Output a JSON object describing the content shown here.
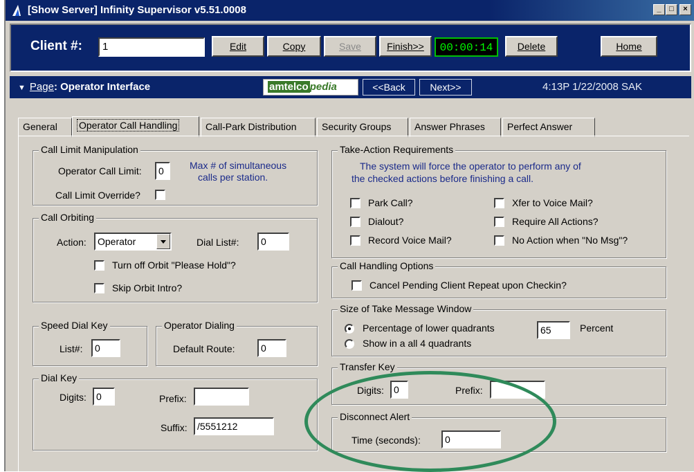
{
  "window": {
    "title": "[Show Server]  Infinity Supervisor  v5.51.0008",
    "controls": [
      "_",
      "□",
      "×"
    ]
  },
  "client_row": {
    "label": "Client #:",
    "client_value": "1",
    "buttons": {
      "edit": "Edit",
      "copy": "Copy",
      "save": "Save",
      "finish": "Finish>>",
      "delete": "Delete",
      "home": "Home"
    },
    "timer": "00:00:14"
  },
  "page_row": {
    "page_prefix": "Page",
    "page_name": ": Operator Interface",
    "logo_box": "amtelco",
    "logo_text": "pedia",
    "back": "<<Back",
    "next": "Next>>",
    "datetime": "4:13P  1/22/2008  SAK"
  },
  "tabs": [
    {
      "label": "General"
    },
    {
      "label": "Operator Call Handling"
    },
    {
      "label": "Call-Park Distribution"
    },
    {
      "label": "Security Groups"
    },
    {
      "label": "Answer Phrases"
    },
    {
      "label": "Perfect Answer"
    }
  ],
  "call_limit": {
    "legend": "Call Limit Manipulation",
    "limit_label": "Operator Call Limit:",
    "limit_value": "0",
    "note_line1": "Max # of simultaneous",
    "note_line2": "calls per station.",
    "override_label": "Call Limit Override?"
  },
  "call_orbiting": {
    "legend": "Call Orbiting",
    "action_label": "Action:",
    "action_value": "Operator",
    "dial_list_label": "Dial List#:",
    "dial_list_value": "0",
    "turn_off_label": "Turn off Orbit \"Please Hold\"?",
    "skip_intro_label": "Skip Orbit Intro?"
  },
  "speed_dial": {
    "legend": "Speed Dial Key",
    "list_label": "List#:",
    "list_value": "0"
  },
  "operator_dialing": {
    "legend": "Operator Dialing",
    "route_label": "Default Route:",
    "route_value": "0"
  },
  "dial_key": {
    "legend": "Dial Key",
    "digits_label": "Digits:",
    "digits_value": "0",
    "prefix_label": "Prefix:",
    "prefix_value": "",
    "suffix_label": "Suffix:",
    "suffix_value": "/5551212"
  },
  "take_action": {
    "legend": "Take-Action Requirements",
    "note_line1": "The system will force the operator to perform any of",
    "note_line2": "the checked actions before finishing a call.",
    "park_call": "Park Call?",
    "dialout": "Dialout?",
    "record_vm": "Record Voice Mail?",
    "xfer_vm": "Xfer to Voice Mail?",
    "require_all": "Require All Actions?",
    "no_action": "No Action when \"No Msg\"?"
  },
  "call_handling": {
    "legend": "Call Handling Options",
    "cancel_pending": "Cancel Pending Client Repeat upon Checkin?"
  },
  "take_message": {
    "legend": "Size of Take Message Window",
    "pct_label": "Percentage of lower quadrants",
    "pct_value": "65",
    "percent_label": "Percent",
    "all_label": "Show in a all 4 quadrants"
  },
  "transfer_key": {
    "legend": "Transfer Key",
    "digits_label": "Digits:",
    "digits_value": "0",
    "prefix_label": "Prefix:",
    "prefix_value": ""
  },
  "disconnect_alert": {
    "legend": "Disconnect Alert",
    "time_label": "Time (seconds):",
    "time_value": "0"
  },
  "colors": {
    "titlebar": "#0a246a",
    "face": "#d4d0c8",
    "timer_text": "#00ff00",
    "annotation_oval": "#2f8a5a"
  }
}
